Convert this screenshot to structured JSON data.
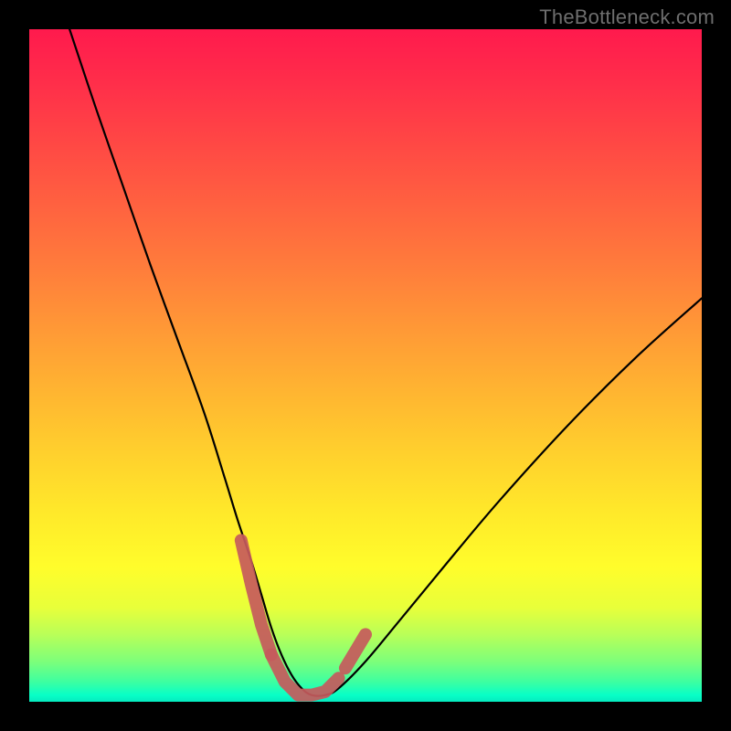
{
  "watermark": {
    "text": "TheBottleneck.com"
  },
  "colors": {
    "frame": "#000000",
    "curve_stroke": "#000000",
    "highlight_stroke": "#c55a5c",
    "gradient_top": "#ff1a4d",
    "gradient_bottom": "#05ebc0"
  },
  "chart_data": {
    "type": "line",
    "title": "",
    "xlabel": "",
    "ylabel": "",
    "xlim": [
      0,
      100
    ],
    "ylim": [
      0,
      100
    ],
    "grid": false,
    "series": [
      {
        "name": "bottleneck-curve",
        "x": [
          6,
          10,
          14,
          18,
          22,
          26,
          29,
          31,
          33,
          34.5,
          36,
          37.5,
          39,
          40.5,
          42,
          44,
          46,
          50,
          55,
          62,
          70,
          80,
          90,
          100
        ],
        "y": [
          100,
          88,
          76.5,
          65,
          54,
          43,
          33.5,
          27,
          21,
          16,
          11,
          7,
          4,
          2,
          1,
          1,
          2,
          6,
          12,
          20.5,
          30,
          41,
          51,
          60
        ]
      }
    ],
    "annotations": [
      {
        "name": "well-highlight",
        "type": "segmented-marker",
        "stroke": "#c55a5c",
        "segments": [
          {
            "x": [
              31.5,
              33.0,
              34.5,
              36.0
            ],
            "y": [
              24.0,
              17.5,
              11.5,
              7.0
            ]
          },
          {
            "x": [
              36.0,
              38.0,
              40.0,
              42.0,
              44.0,
              46.0
            ],
            "y": [
              7.0,
              3.0,
              1.0,
              1.0,
              1.5,
              3.5
            ]
          },
          {
            "x": [
              47.0,
              48.5,
              50.0
            ],
            "y": [
              5.0,
              7.5,
              10.0
            ]
          }
        ]
      }
    ]
  }
}
